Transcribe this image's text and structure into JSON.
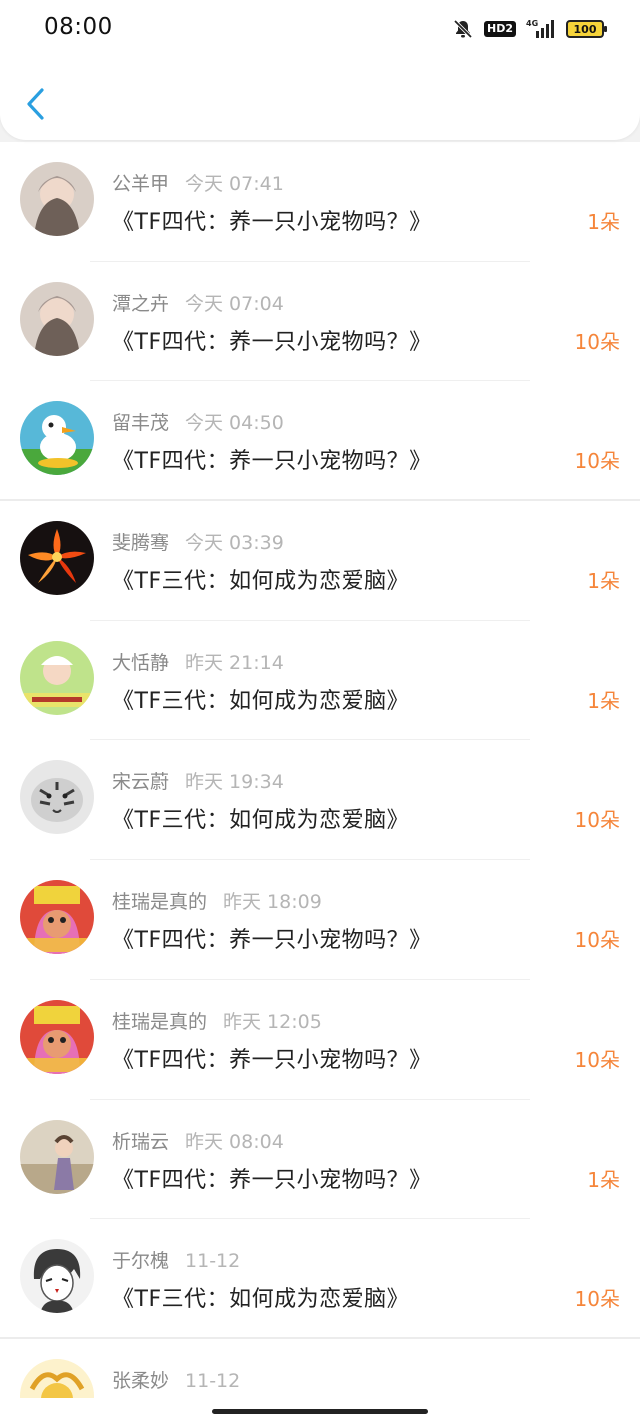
{
  "status_bar": {
    "time": "08:00",
    "network": "4G",
    "hd_label": "HD2",
    "battery": "100"
  },
  "header": {
    "back_icon": "chevron-left-icon",
    "accent_color": "#2a9fe0"
  },
  "colors": {
    "count": "#f5853a",
    "name": "#8a8a8a",
    "timestamp": "#b5b5b5"
  },
  "items": [
    {
      "name": "公羊甲",
      "time": "今天 07:41",
      "title": "《TF四代：养一只小宠物吗？》",
      "count": "1朵",
      "avatar": "portrait-girl-avatar"
    },
    {
      "name": "潭之卉",
      "time": "今天 07:04",
      "title": "《TF四代：养一只小宠物吗？》",
      "count": "10朵",
      "avatar": "portrait-girl-avatar"
    },
    {
      "name": "留丰茂",
      "time": "今天 04:50",
      "title": "《TF四代：养一只小宠物吗？》",
      "count": "10朵",
      "avatar": "cartoon-duck-avatar"
    },
    {
      "name": "斐腾骞",
      "time": "今天 03:39",
      "title": "《TF三代：如何成为恋爱脑》",
      "count": "1朵",
      "avatar": "fire-flower-avatar"
    },
    {
      "name": "大恬静",
      "time": "昨天 21:14",
      "title": "《TF三代：如何成为恋爱脑》",
      "count": "1朵",
      "avatar": "girl-cap-avatar"
    },
    {
      "name": "宋云蔚",
      "time": "昨天 19:34",
      "title": "《TF三代：如何成为恋爱脑》",
      "count": "10朵",
      "avatar": "tiger-avatar"
    },
    {
      "name": "桂瑞是真的",
      "time": "昨天 18:09",
      "title": "《TF四代：养一只小宠物吗？》",
      "count": "10朵",
      "avatar": "cartoon-character-avatar"
    },
    {
      "name": "桂瑞是真的",
      "time": "昨天 12:05",
      "title": "《TF四代：养一只小宠物吗？》",
      "count": "10朵",
      "avatar": "cartoon-character-avatar"
    },
    {
      "name": "析瑞云",
      "time": "昨天 08:04",
      "title": "《TF四代：养一只小宠物吗？》",
      "count": "1朵",
      "avatar": "child-photo-avatar"
    },
    {
      "name": "于尔槐",
      "time": "11-12",
      "title": "《TF三代：如何成为恋爱脑》",
      "count": "10朵",
      "avatar": "anime-sketch-avatar"
    },
    {
      "name": "张柔妙",
      "time": "11-12",
      "title": "",
      "count": "",
      "avatar": "golden-character-avatar"
    }
  ]
}
